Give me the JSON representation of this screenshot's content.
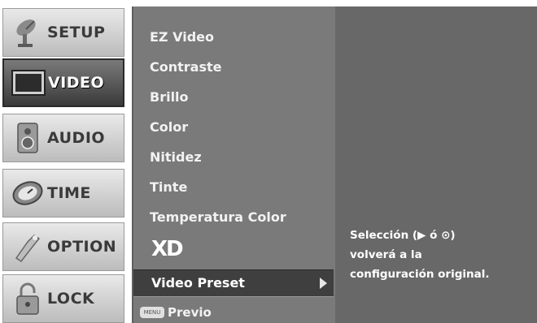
{
  "left_menu": {
    "items": [
      {
        "label": "SETUP",
        "icon": "satellite-dish-icon",
        "selected": false
      },
      {
        "label": "VIDEO",
        "icon": "tv-screen-icon",
        "selected": true
      },
      {
        "label": "AUDIO",
        "icon": "speaker-icon",
        "selected": false
      },
      {
        "label": "TIME",
        "icon": "clock-icon",
        "selected": false
      },
      {
        "label": "OPTION",
        "icon": "option-icon",
        "selected": false
      },
      {
        "label": "LOCK",
        "icon": "padlock-icon",
        "selected": false
      }
    ]
  },
  "submenu": {
    "items": [
      "EZ Video",
      "Contraste",
      "Brillo",
      "Color",
      "Nitidez",
      "Tinte",
      "Temperatura Color"
    ],
    "xd_logo": "XD",
    "highlighted_item": "Video Preset",
    "prev_key": "MENU",
    "prev_label": "Previo"
  },
  "info_panel": {
    "lines": [
      "Selección (▶ ó ⊙)",
      "volverá a la",
      "configuración original."
    ]
  },
  "colors": {
    "panel": "#7a7a7a",
    "info_panel": "#686868",
    "selected_row": "#3f3f3f"
  }
}
